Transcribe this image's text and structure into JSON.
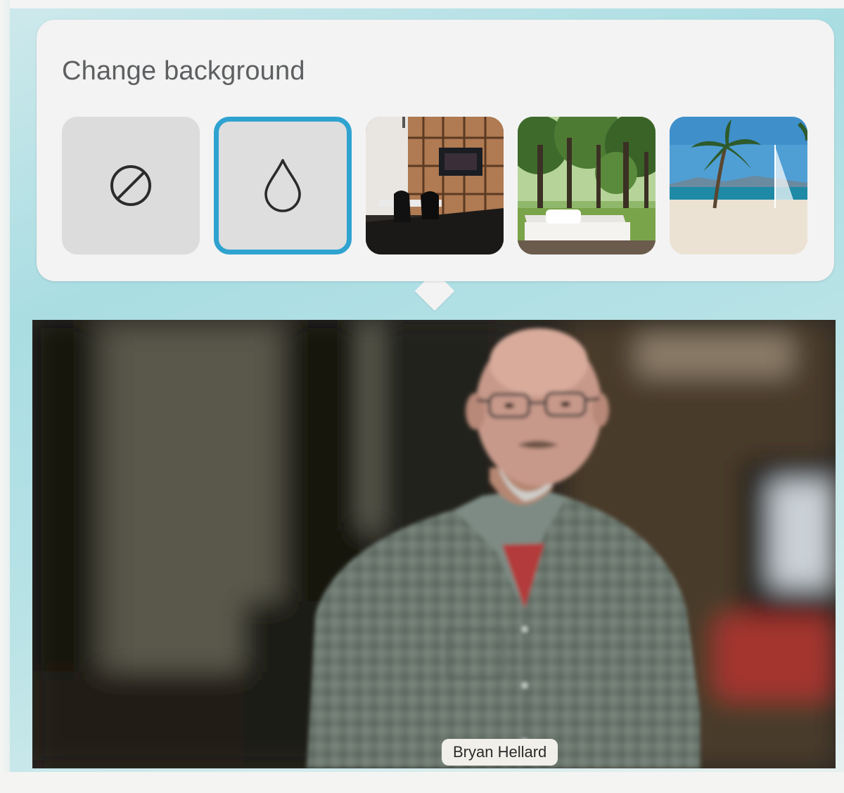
{
  "popover": {
    "title": "Change background",
    "options": [
      {
        "id": "none",
        "icon": "no-background-icon",
        "selected": false
      },
      {
        "id": "blur",
        "icon": "blur-drop-icon",
        "selected": true
      },
      {
        "id": "office",
        "icon": "office-image",
        "selected": false
      },
      {
        "id": "forest",
        "icon": "forest-image",
        "selected": false
      },
      {
        "id": "beach",
        "icon": "beach-image",
        "selected": false
      }
    ]
  },
  "video": {
    "participant_name": "Bryan Hellard"
  },
  "colors": {
    "selected_border": "#2fa3d0",
    "popover_bg": "#f3f3f3",
    "title_text": "#5d5f61"
  }
}
